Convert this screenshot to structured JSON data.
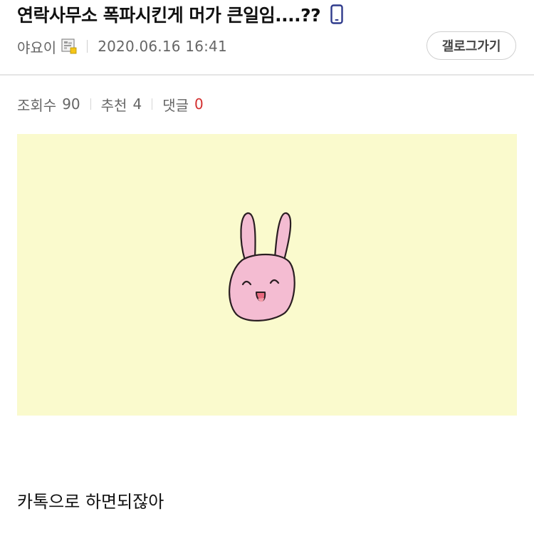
{
  "post": {
    "title": "연락사무소 폭파시킨게 머가 큰일임....??",
    "author": "야요이",
    "date": "2020.06.16 16:41",
    "gallery_button": "갤로그가기"
  },
  "stats": {
    "views_label": "조회수",
    "views": "90",
    "recommend_label": "추천",
    "recommend": "4",
    "comments_label": "댓글",
    "comments": "0"
  },
  "content": {
    "body": "카톡으로 하면되잖아"
  },
  "icons": {
    "mobile": "mobile-phone-icon",
    "nick": "fixed-nick-icon"
  },
  "colors": {
    "image_background": "#fafacd",
    "rabbit_pink": "#f4bcd2",
    "comment_count": "#d32f2f",
    "mobile_icon": "#2f3b8c"
  }
}
